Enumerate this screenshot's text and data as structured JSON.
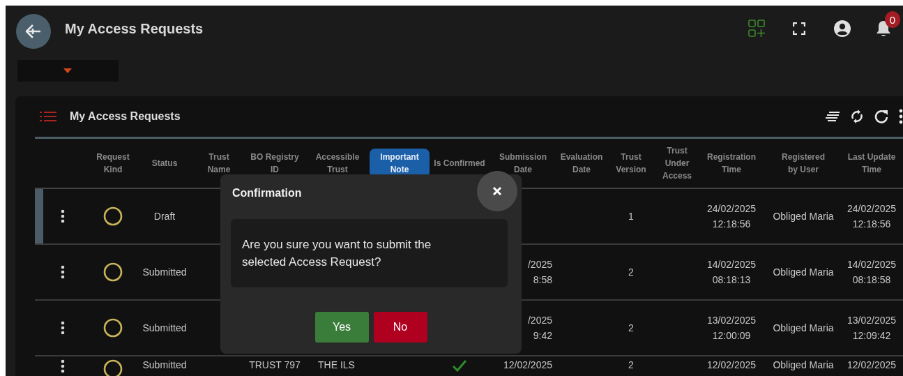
{
  "app_bar": {
    "title": "My Access Requests",
    "notification_count": "0"
  },
  "panel": {
    "title": "My Access Requests"
  },
  "table": {
    "columns": [
      {
        "label": "Request Kind",
        "highlighted": false
      },
      {
        "label": "Status",
        "highlighted": false
      },
      {
        "label": "Trust Name",
        "highlighted": false
      },
      {
        "label": "BO Registry ID",
        "highlighted": false
      },
      {
        "label": "Accessible Trust",
        "highlighted": false
      },
      {
        "label": "Important Note",
        "highlighted": true
      },
      {
        "label": "Is Confirmed",
        "highlighted": false
      },
      {
        "label": "Submission Date",
        "highlighted": false
      },
      {
        "label": "Evaluation Date",
        "highlighted": false
      },
      {
        "label": "Trust Version",
        "highlighted": false
      },
      {
        "label": "Trust Under Access",
        "highlighted": false
      },
      {
        "label": "Registration Time",
        "highlighted": false
      },
      {
        "label": "Registered by User",
        "highlighted": false
      },
      {
        "label": "Last Update Time",
        "highlighted": false
      }
    ],
    "rows": [
      {
        "selected": true,
        "status": "Draft",
        "trust_version": "1",
        "registration_time": "24/02/2025\n12:18:56",
        "registered_by_user": "Obliged Maria",
        "last_update_time": "24/02/2025\n12:18:56"
      },
      {
        "selected": false,
        "status": "Submitted",
        "submission_date": "/2025\n8:58",
        "trust_version": "2",
        "registration_time": "14/02/2025\n08:18:13",
        "registered_by_user": "Obliged Maria",
        "last_update_time": "14/02/2025\n08:18:58"
      },
      {
        "selected": false,
        "status": "Submitted",
        "submission_date": "/2025\n9:42",
        "trust_version": "2",
        "registration_time": "13/02/2025\n12:00:09",
        "registered_by_user": "Obliged Maria",
        "last_update_time": "13/02/2025\n12:09:42"
      },
      {
        "selected": false,
        "status": "Submitted",
        "bo_registry_id": "TRUST 797",
        "accessible_trust": "THE ILS",
        "is_confirmed": true,
        "submission_date": "12/02/2025",
        "trust_version": "2",
        "registration_time": "12/02/2025",
        "registered_by_user": "Obliged Maria",
        "last_update_time": "12/02/2025"
      }
    ]
  },
  "dialog": {
    "title": "Confirmation",
    "message": "Are you sure you want to submit the selected Access Request?",
    "buttons": [
      {
        "label": "Yes",
        "kind": "confirm"
      },
      {
        "label": "No",
        "kind": "cancel"
      }
    ]
  }
}
